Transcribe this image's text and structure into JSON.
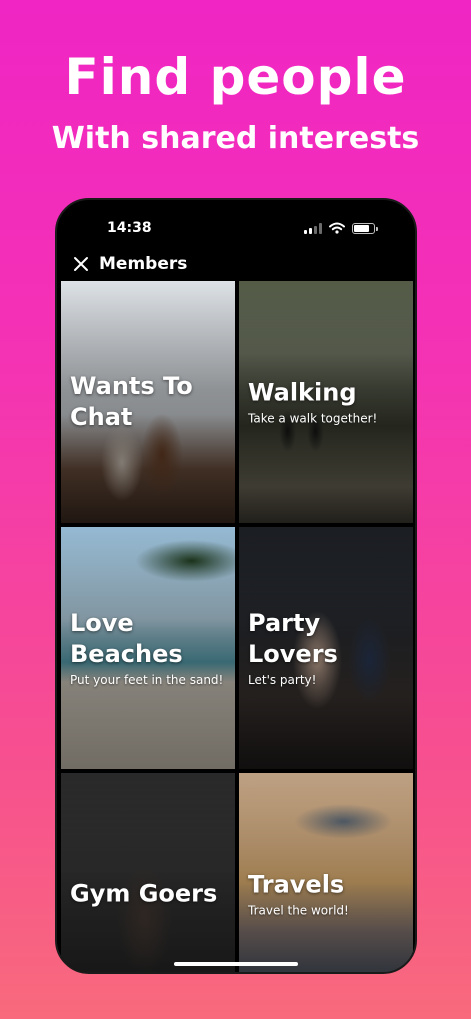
{
  "promo": {
    "headline": "Find people",
    "subhead": "With shared interests"
  },
  "status_bar": {
    "time": "14:38"
  },
  "nav": {
    "title": "Members",
    "close_icon": "close-icon"
  },
  "tiles": [
    {
      "title": "Wants To Chat",
      "subtitle": ""
    },
    {
      "title": "Walking",
      "subtitle": "Take a walk together!"
    },
    {
      "title": "Love Beaches",
      "subtitle": "Put your feet in the sand!"
    },
    {
      "title": "Party Lovers",
      "subtitle": "Let's party!"
    },
    {
      "title": "Gym Goers",
      "subtitle": ""
    },
    {
      "title": "Travels",
      "subtitle": "Travel the world!"
    }
  ],
  "colors": {
    "background_top": "#f025c4",
    "background_bottom": "#f86a7c",
    "text": "#ffffff",
    "phone": "#000000"
  }
}
